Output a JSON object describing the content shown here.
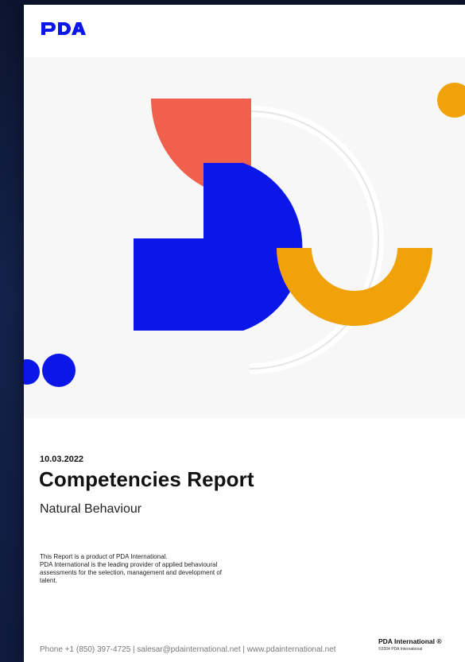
{
  "colors": {
    "brand_blue": "#0b17e8",
    "accent_red": "#f0604c",
    "accent_orange": "#f0a208",
    "background": "#ffffff",
    "art_background": "#f7f7f7",
    "viewer_background": "#0f1a3d"
  },
  "header": {
    "logo_text": "PDA",
    "logo_icon": "pda-logo"
  },
  "report": {
    "date": "10.03.2022",
    "title": "Competencies Report",
    "subtitle": "Natural Behaviour",
    "blurb_lines": [
      "This Report is a product of PDA International.",
      "PDA International is the leading provider of applied behavioural",
      "assessments for the selection, management and development of",
      "talent."
    ]
  },
  "footer": {
    "contact": "Phone +1 (850) 397-4725 | salesar@pdainternational.net | www.pdainternational.net",
    "brand": "PDA International ®",
    "copyright": "©2004 PDA International"
  }
}
